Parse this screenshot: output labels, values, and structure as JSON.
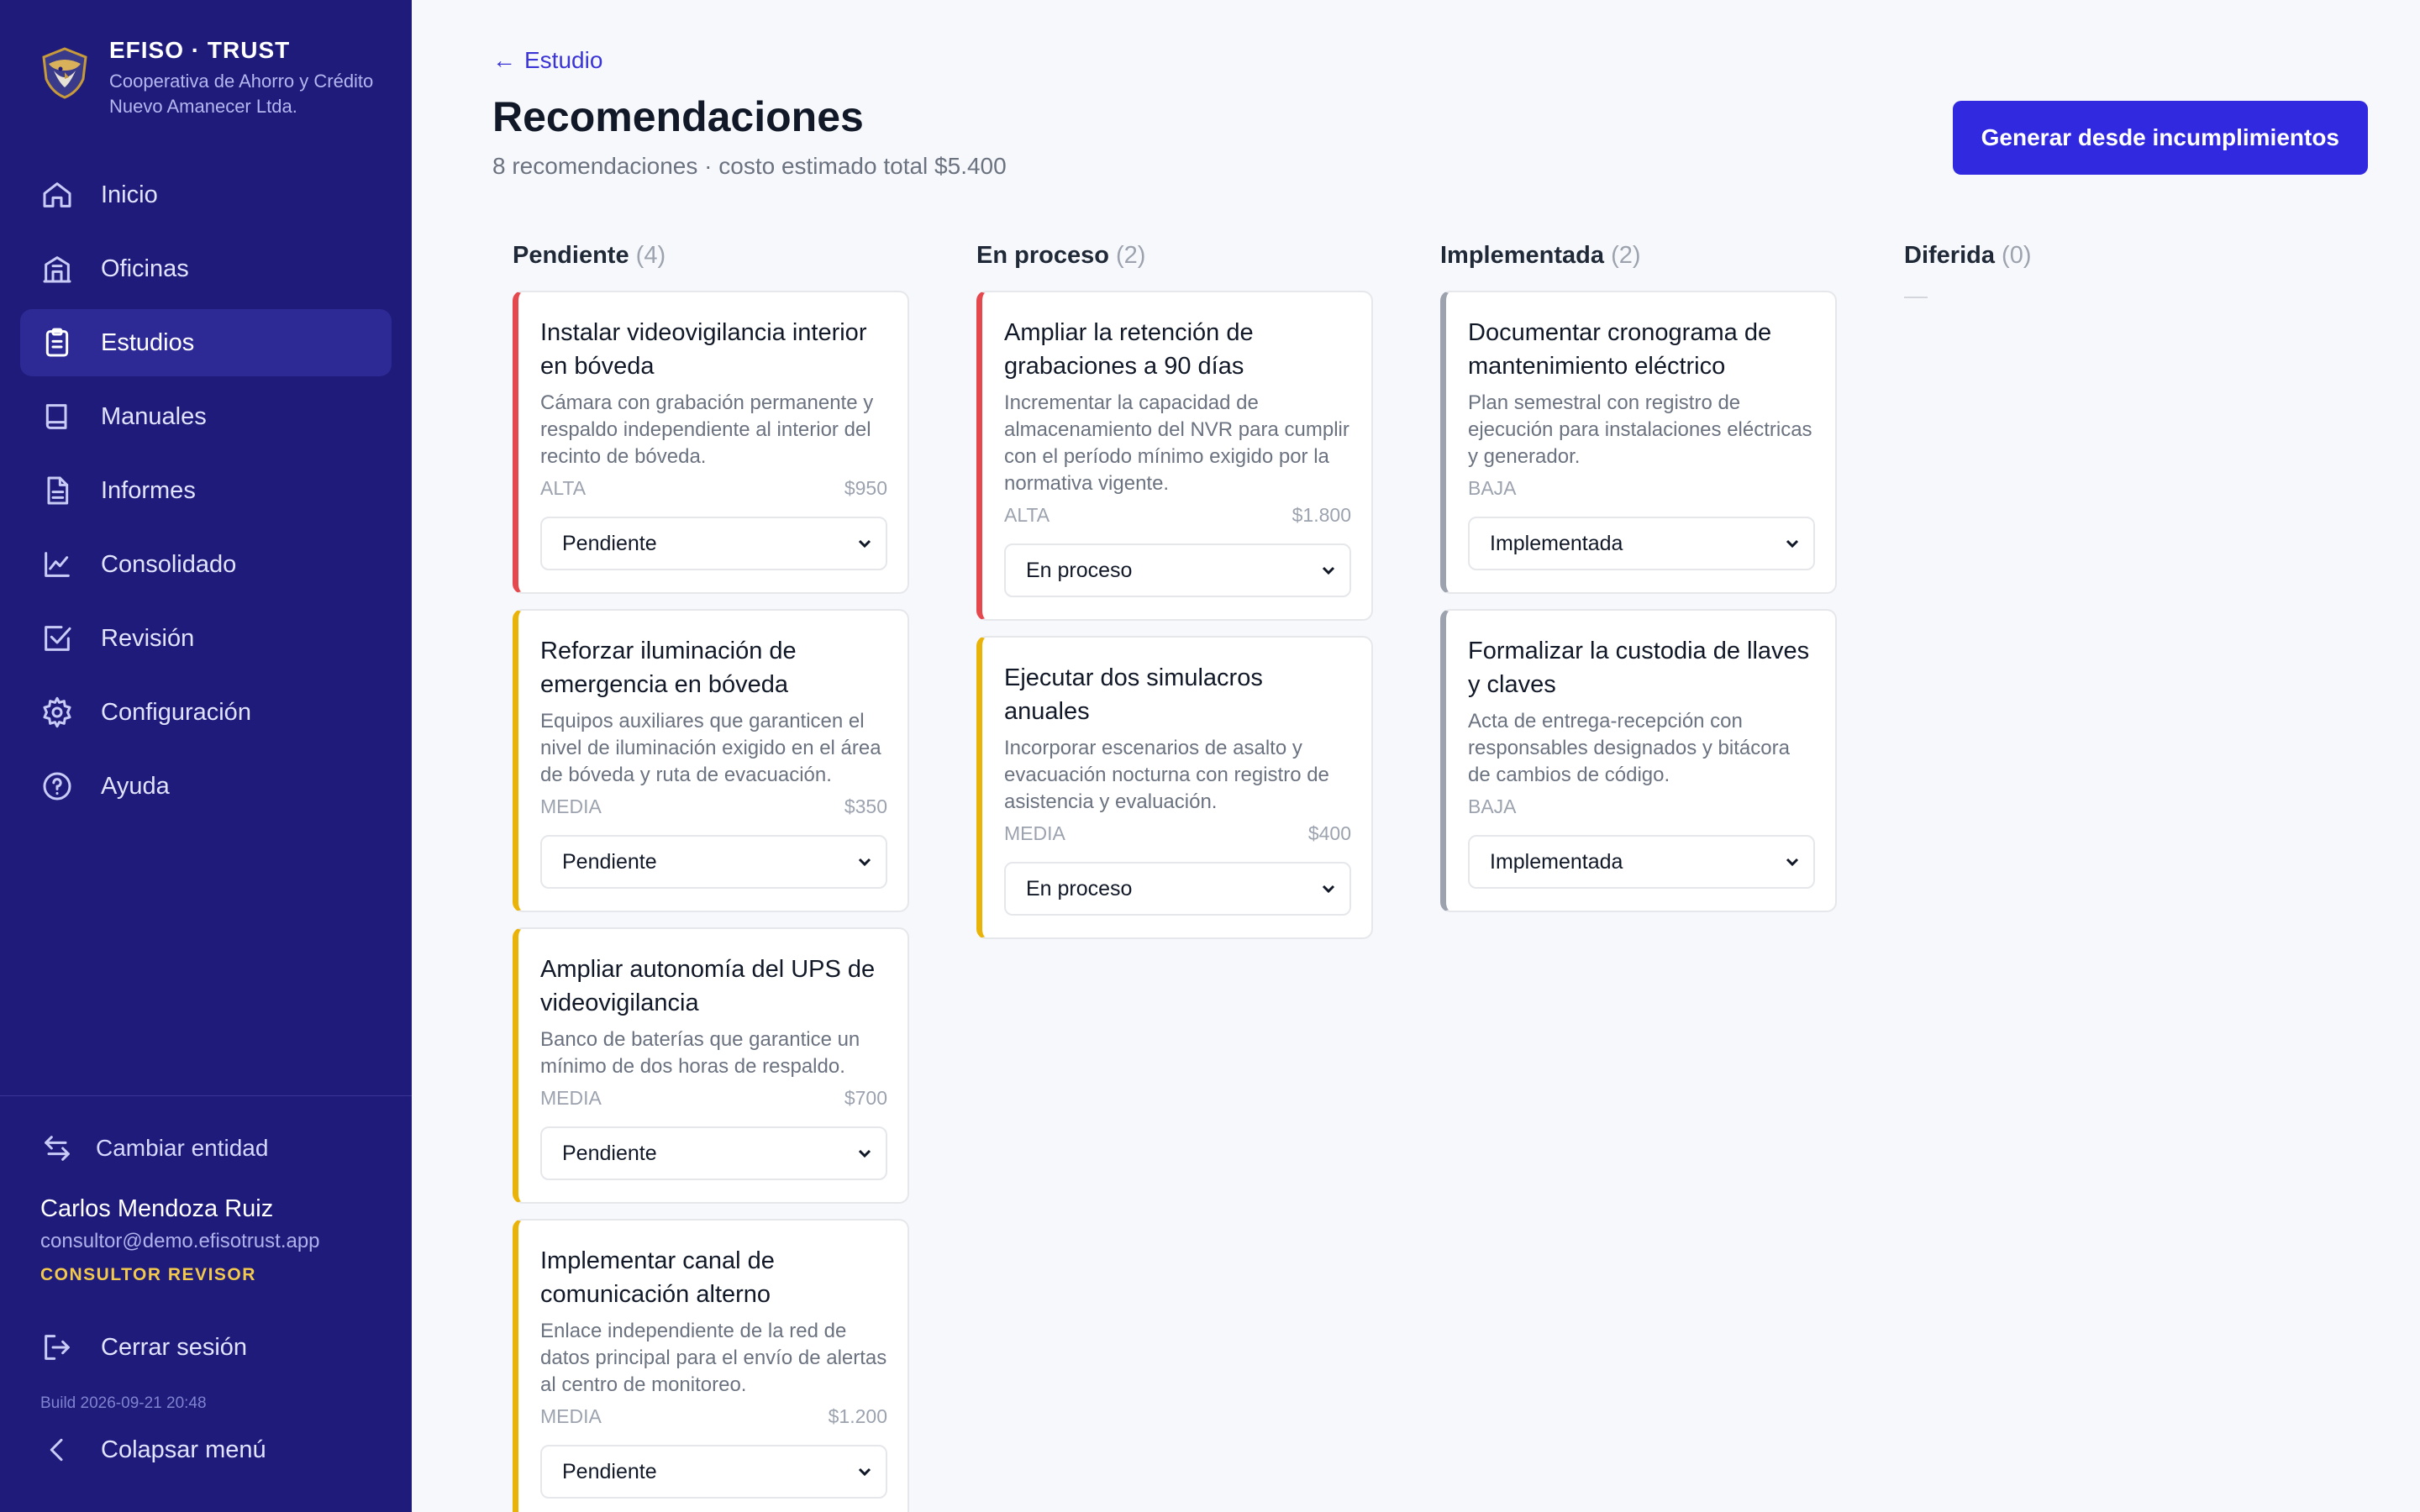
{
  "brand": {
    "title": "EFISO · TRUST",
    "subtitle": "Cooperativa de Ahorro y Crédito Nuevo Amanecer Ltda."
  },
  "nav": [
    {
      "label": "Inicio",
      "icon": "home-icon"
    },
    {
      "label": "Oficinas",
      "icon": "building-icon"
    },
    {
      "label": "Estudios",
      "icon": "clipboard-icon"
    },
    {
      "label": "Manuales",
      "icon": "book-icon"
    },
    {
      "label": "Informes",
      "icon": "document-icon"
    },
    {
      "label": "Consolidado",
      "icon": "chart-icon"
    },
    {
      "label": "Revisión",
      "icon": "checkbox-icon"
    },
    {
      "label": "Configuración",
      "icon": "gear-icon"
    },
    {
      "label": "Ayuda",
      "icon": "help-icon"
    }
  ],
  "active_nav": "Estudios",
  "sidebar_footer": {
    "switch_label": "Cambiar entidad",
    "user_name": "Carlos Mendoza Ruiz",
    "user_email": "consultor@demo.efisotrust.app",
    "user_role": "CONSULTOR REVISOR",
    "logout_label": "Cerrar sesión",
    "build": "Build 2026-09-21 20:48",
    "collapse_label": "Colapsar menú"
  },
  "header": {
    "back_label": "Estudio",
    "title": "Recomendaciones",
    "subtitle": "8 recomendaciones · costo estimado total $5.400",
    "generate_label": "Generar desde incumplimientos"
  },
  "columns": [
    {
      "name": "Pendiente",
      "count": "(4)",
      "cards": [
        {
          "title": "Instalar videovigilancia interior en bóveda",
          "desc": "Cámara con grabación permanente y respaldo independiente al interior del recinto de bóveda.",
          "priority": "ALTA",
          "cost": "$950",
          "status": "Pendiente"
        },
        {
          "title": "Reforzar iluminación de emergencia en bóveda",
          "desc": "Equipos auxiliares que garanticen el nivel de iluminación exigido en el área de bóveda y ruta de evacuación.",
          "priority": "MEDIA",
          "cost": "$350",
          "status": "Pendiente"
        },
        {
          "title": "Ampliar autonomía del UPS de videovigilancia",
          "desc": "Banco de baterías que garantice un mínimo de dos horas de respaldo.",
          "priority": "MEDIA",
          "cost": "$700",
          "status": "Pendiente"
        },
        {
          "title": "Implementar canal de comunicación alterno",
          "desc": "Enlace independiente de la red de datos principal para el envío de alertas al centro de monitoreo.",
          "priority": "MEDIA",
          "cost": "$1.200",
          "status": "Pendiente"
        }
      ]
    },
    {
      "name": "En proceso",
      "count": "(2)",
      "cards": [
        {
          "title": "Ampliar la retención de grabaciones a 90 días",
          "desc": "Incrementar la capacidad de almacenamiento del NVR para cumplir con el período mínimo exigido por la normativa vigente.",
          "priority": "ALTA",
          "cost": "$1.800",
          "status": "En proceso"
        },
        {
          "title": "Ejecutar dos simulacros anuales",
          "desc": "Incorporar escenarios de asalto y evacuación nocturna con registro de asistencia y evaluación.",
          "priority": "MEDIA",
          "cost": "$400",
          "status": "En proceso"
        }
      ]
    },
    {
      "name": "Implementada",
      "count": "(2)",
      "cards": [
        {
          "title": "Documentar cronograma de mantenimiento eléctrico",
          "desc": "Plan semestral con registro de ejecución para instalaciones eléctricas y generador.",
          "priority": "BAJA",
          "cost": "",
          "status": "Implementada"
        },
        {
          "title": "Formalizar la custodia de llaves y claves",
          "desc": "Acta de entrega-recepción con responsables designados y bitácora de cambios de código.",
          "priority": "BAJA",
          "cost": "",
          "status": "Implementada"
        }
      ]
    },
    {
      "name": "Diferida",
      "count": "(0)",
      "empty_text": "—",
      "cards": []
    }
  ],
  "colors": {
    "sidebar": "#1f1b7a",
    "accent": "#3029e0",
    "alta": "#e5484d",
    "media": "#eab308",
    "baja": "#9ca3af",
    "role": "#f2c94c"
  }
}
